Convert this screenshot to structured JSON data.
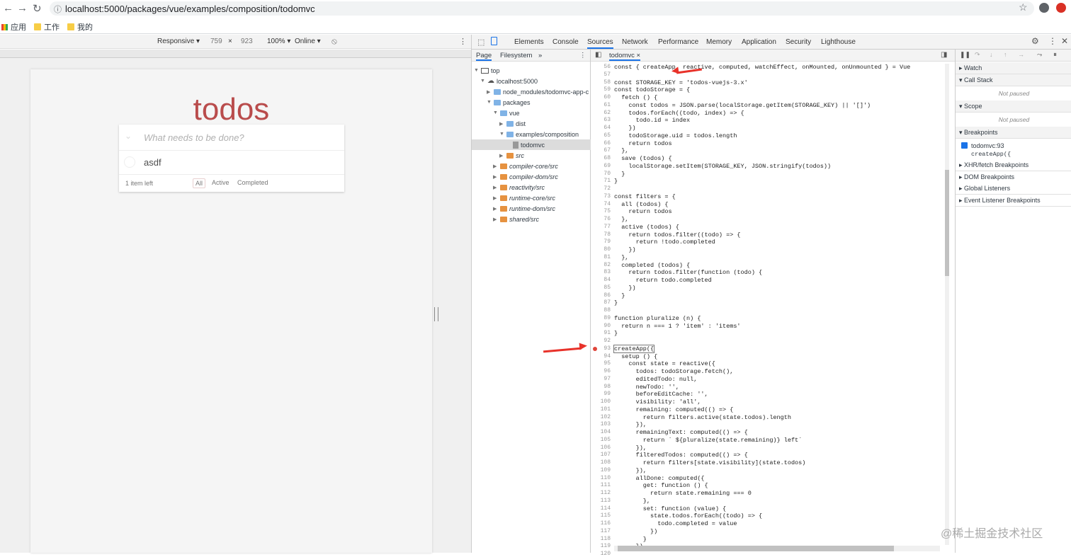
{
  "browser": {
    "url": "localhost:5000/packages/vue/examples/composition/todomvc",
    "bookmarks": [
      "应用",
      "工作",
      "我的"
    ]
  },
  "device_toolbar": {
    "mode": "Responsive ▾",
    "width": "759",
    "times": "×",
    "height": "923",
    "zoom": "100% ▾",
    "network": "Online ▾"
  },
  "todo_app": {
    "title": "todos",
    "placeholder": "What needs to be done?",
    "items": [
      "asdf"
    ],
    "count_text": "1 item left",
    "filters": [
      "All",
      "Active",
      "Completed"
    ]
  },
  "devtools": {
    "tabs": [
      "Elements",
      "Console",
      "Sources",
      "Network",
      "Performance",
      "Memory",
      "Application",
      "Security",
      "Lighthouse"
    ],
    "active_tab": "Sources",
    "navigator_tabs": [
      "Page",
      "Filesystem",
      "»"
    ],
    "tree": [
      {
        "label": "top",
        "depth": 0
      },
      {
        "label": "localhost:5000",
        "depth": 1
      },
      {
        "label": "node_modules/todomvc-app-c",
        "depth": 2
      },
      {
        "label": "packages",
        "depth": 2
      },
      {
        "label": "vue",
        "depth": 3
      },
      {
        "label": "dist",
        "depth": 4
      },
      {
        "label": "examples/composition",
        "depth": 4
      },
      {
        "label": "todomvc",
        "depth": 5
      },
      {
        "label": "src",
        "depth": 4
      },
      {
        "label": "compiler-core/src",
        "depth": 3
      },
      {
        "label": "compiler-dom/src",
        "depth": 3
      },
      {
        "label": "reactivity/src",
        "depth": 3
      },
      {
        "label": "runtime-core/src",
        "depth": 3
      },
      {
        "label": "runtime-dom/src",
        "depth": 3
      },
      {
        "label": "shared/src",
        "depth": 3
      }
    ],
    "open_file": "todomvc ×",
    "code": [
      {
        "n": "56",
        "t": "const { createApp, reactive, computed, watchEffect, onMounted, onUnmounted } = Vue"
      },
      {
        "n": "57",
        "t": ""
      },
      {
        "n": "58",
        "t": "const STORAGE_KEY = 'todos-vuejs-3.x'"
      },
      {
        "n": "59",
        "t": "const todoStorage = {"
      },
      {
        "n": "60",
        "t": "  fetch () {"
      },
      {
        "n": "61",
        "t": "    const todos = JSON.parse(localStorage.getItem(STORAGE_KEY) || '[]')"
      },
      {
        "n": "62",
        "t": "    todos.forEach((todo, index) => {"
      },
      {
        "n": "63",
        "t": "      todo.id = index"
      },
      {
        "n": "64",
        "t": "    })"
      },
      {
        "n": "65",
        "t": "    todoStorage.uid = todos.length"
      },
      {
        "n": "66",
        "t": "    return todos"
      },
      {
        "n": "67",
        "t": "  },"
      },
      {
        "n": "68",
        "t": "  save (todos) {"
      },
      {
        "n": "69",
        "t": "    localStorage.setItem(STORAGE_KEY, JSON.stringify(todos))"
      },
      {
        "n": "70",
        "t": "  }"
      },
      {
        "n": "71",
        "t": "}"
      },
      {
        "n": "72",
        "t": ""
      },
      {
        "n": "73",
        "t": "const filters = {"
      },
      {
        "n": "74",
        "t": "  all (todos) {"
      },
      {
        "n": "75",
        "t": "    return todos"
      },
      {
        "n": "76",
        "t": "  },"
      },
      {
        "n": "77",
        "t": "  active (todos) {"
      },
      {
        "n": "78",
        "t": "    return todos.filter((todo) => {"
      },
      {
        "n": "79",
        "t": "      return !todo.completed"
      },
      {
        "n": "80",
        "t": "    })"
      },
      {
        "n": "81",
        "t": "  },"
      },
      {
        "n": "82",
        "t": "  completed (todos) {"
      },
      {
        "n": "83",
        "t": "    return todos.filter(function (todo) {"
      },
      {
        "n": "84",
        "t": "      return todo.completed"
      },
      {
        "n": "85",
        "t": "    })"
      },
      {
        "n": "86",
        "t": "  }"
      },
      {
        "n": "87",
        "t": "}"
      },
      {
        "n": "88",
        "t": ""
      },
      {
        "n": "89",
        "t": "function pluralize (n) {"
      },
      {
        "n": "90",
        "t": "  return n === 1 ? 'item' : 'items'"
      },
      {
        "n": "91",
        "t": "}"
      },
      {
        "n": "92",
        "t": ""
      },
      {
        "n": "93",
        "t": "createApp({"
      },
      {
        "n": "94",
        "t": "  setup () {"
      },
      {
        "n": "95",
        "t": "    const state = reactive({"
      },
      {
        "n": "96",
        "t": "      todos: todoStorage.fetch(),"
      },
      {
        "n": "97",
        "t": "      editedTodo: null,"
      },
      {
        "n": "98",
        "t": "      newTodo: '',"
      },
      {
        "n": "99",
        "t": "      beforeEditCache: '',"
      },
      {
        "n": "100",
        "t": "      visibility: 'all',"
      },
      {
        "n": "101",
        "t": "      remaining: computed(() => {"
      },
      {
        "n": "102",
        "t": "        return filters.active(state.todos).length"
      },
      {
        "n": "103",
        "t": "      }),"
      },
      {
        "n": "104",
        "t": "      remainingText: computed(() => {"
      },
      {
        "n": "105",
        "t": "        return ` ${pluralize(state.remaining)} left`"
      },
      {
        "n": "106",
        "t": "      }),"
      },
      {
        "n": "107",
        "t": "      filteredTodos: computed(() => {"
      },
      {
        "n": "108",
        "t": "        return filters[state.visibility](state.todos)"
      },
      {
        "n": "109",
        "t": "      }),"
      },
      {
        "n": "110",
        "t": "      allDone: computed({"
      },
      {
        "n": "111",
        "t": "        get: function () {"
      },
      {
        "n": "112",
        "t": "          return state.remaining === 0"
      },
      {
        "n": "113",
        "t": "        },"
      },
      {
        "n": "114",
        "t": "        set: function (value) {"
      },
      {
        "n": "115",
        "t": "          state.todos.forEach((todo) => {"
      },
      {
        "n": "116",
        "t": "            todo.completed = value"
      },
      {
        "n": "117",
        "t": "          })"
      },
      {
        "n": "118",
        "t": "        }"
      },
      {
        "n": "119",
        "t": "      }),"
      },
      {
        "n": "120",
        "t": ""
      }
    ],
    "debugger": {
      "watch": "Watch",
      "call_stack": "Call Stack",
      "not_paused_1": "Not paused",
      "scope": "Scope",
      "not_paused_2": "Not paused",
      "breakpoints": "Breakpoints",
      "bp_file": "todomvc:93",
      "bp_code": "createApp({",
      "xhr": "XHR/fetch Breakpoints",
      "dom": "DOM Breakpoints",
      "global": "Global Listeners",
      "event": "Event Listener Breakpoints"
    }
  },
  "watermark": "@稀土掘金技术社区",
  "accent_colors": {
    "todo_title": "#af2f2f",
    "breakpoint": "#e0453a",
    "arrow": "#e8322a"
  }
}
